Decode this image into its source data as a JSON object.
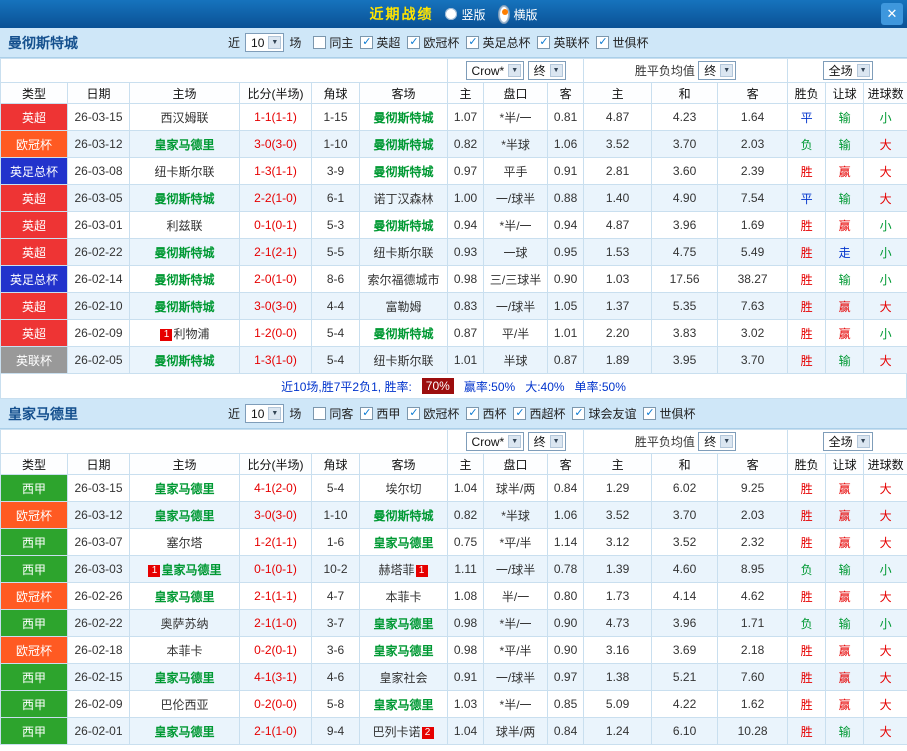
{
  "icons": {
    "chevron_down": "▼",
    "check": "✓",
    "close": "✕"
  },
  "colors": {
    "result": {
      "r": "#e60000",
      "g": "#009933",
      "b": "#0033cc"
    }
  },
  "top_bar": {
    "title": "近期战绩",
    "radio_vertical": "竖版",
    "radio_horizontal": "横版"
  },
  "sections": [
    {
      "team": "曼彻斯特城",
      "near_label": "近",
      "count_value": "10",
      "games_label": "场",
      "filters": [
        {
          "label": "同主",
          "checked": false
        },
        {
          "label": "英超",
          "checked": true
        },
        {
          "label": "欧冠杯",
          "checked": true
        },
        {
          "label": "英足总杯",
          "checked": true
        },
        {
          "label": "英联杯",
          "checked": true
        },
        {
          "label": "世俱杯",
          "checked": true
        }
      ],
      "odds_source": "Crow*",
      "final_label": "终",
      "avg_label": "胜平负均值",
      "scope_label": "全场",
      "columns": [
        "类型",
        "日期",
        "主场",
        "比分(半场)",
        "角球",
        "客场",
        "主",
        "盘口",
        "客",
        "主",
        "和",
        "客",
        "胜负",
        "让球",
        "进球数"
      ],
      "rows": [
        {
          "type": "英超",
          "type_bg": "#ee3434",
          "date": "26-03-15",
          "home": "西汉姆联",
          "home_hl": false,
          "score": "1-1(1-1)",
          "corner": "1-15",
          "away": "曼彻斯特城",
          "away_hl": true,
          "odds": [
            "1.07",
            "*半/一",
            "0.81",
            "4.87",
            "4.23",
            "1.64"
          ],
          "res": [
            "平",
            "输",
            "小"
          ],
          "res_c": [
            "b",
            "g",
            "g"
          ]
        },
        {
          "type": "欧冠杯",
          "type_bg": "#ff5a22",
          "date": "26-03-12",
          "home": "皇家马德里",
          "home_hl": true,
          "score": "3-0(3-0)",
          "corner": "1-10",
          "away": "曼彻斯特城",
          "away_hl": true,
          "odds": [
            "0.82",
            "*半球",
            "1.06",
            "3.52",
            "3.70",
            "2.03"
          ],
          "res": [
            "负",
            "输",
            "大"
          ],
          "res_c": [
            "g",
            "g",
            "r"
          ]
        },
        {
          "type": "英足总杯",
          "type_bg": "#2233cc",
          "date": "26-03-08",
          "home": "纽卡斯尔联",
          "home_hl": false,
          "score": "1-3(1-1)",
          "corner": "3-9",
          "away": "曼彻斯特城",
          "away_hl": true,
          "odds": [
            "0.97",
            "平手",
            "0.91",
            "2.81",
            "3.60",
            "2.39"
          ],
          "res": [
            "胜",
            "赢",
            "大"
          ],
          "res_c": [
            "r",
            "r",
            "r"
          ]
        },
        {
          "type": "英超",
          "type_bg": "#ee3434",
          "date": "26-03-05",
          "home": "曼彻斯特城",
          "home_hl": true,
          "score": "2-2(1-0)",
          "corner": "6-1",
          "away": "诺丁汉森林",
          "away_hl": false,
          "odds": [
            "1.00",
            "一/球半",
            "0.88",
            "1.40",
            "4.90",
            "7.54"
          ],
          "res": [
            "平",
            "输",
            "大"
          ],
          "res_c": [
            "b",
            "g",
            "r"
          ]
        },
        {
          "type": "英超",
          "type_bg": "#ee3434",
          "date": "26-03-01",
          "home": "利兹联",
          "home_hl": false,
          "score": "0-1(0-1)",
          "corner": "5-3",
          "away": "曼彻斯特城",
          "away_hl": true,
          "odds": [
            "0.94",
            "*半/一",
            "0.94",
            "4.87",
            "3.96",
            "1.69"
          ],
          "res": [
            "胜",
            "赢",
            "小"
          ],
          "res_c": [
            "r",
            "r",
            "g"
          ]
        },
        {
          "type": "英超",
          "type_bg": "#ee3434",
          "date": "26-02-22",
          "home": "曼彻斯特城",
          "home_hl": true,
          "score": "2-1(2-1)",
          "corner": "5-5",
          "away": "纽卡斯尔联",
          "away_hl": false,
          "odds": [
            "0.93",
            "一球",
            "0.95",
            "1.53",
            "4.75",
            "5.49"
          ],
          "res": [
            "胜",
            "走",
            "小"
          ],
          "res_c": [
            "r",
            "b",
            "g"
          ]
        },
        {
          "type": "英足总杯",
          "type_bg": "#2233cc",
          "date": "26-02-14",
          "home": "曼彻斯特城",
          "home_hl": true,
          "score": "2-0(1-0)",
          "corner": "8-6",
          "away": "索尔福德城市",
          "away_hl": false,
          "odds": [
            "0.98",
            "三/三球半",
            "0.90",
            "1.03",
            "17.56",
            "38.27"
          ],
          "res": [
            "胜",
            "输",
            "小"
          ],
          "res_c": [
            "r",
            "g",
            "g"
          ]
        },
        {
          "type": "英超",
          "type_bg": "#ee3434",
          "date": "26-02-10",
          "home": "曼彻斯特城",
          "home_hl": true,
          "score": "3-0(3-0)",
          "corner": "4-4",
          "away": "富勒姆",
          "away_hl": false,
          "odds": [
            "0.83",
            "一/球半",
            "1.05",
            "1.37",
            "5.35",
            "7.63"
          ],
          "res": [
            "胜",
            "赢",
            "大"
          ],
          "res_c": [
            "r",
            "r",
            "r"
          ]
        },
        {
          "type": "英超",
          "type_bg": "#ee3434",
          "date": "26-02-09",
          "home": "利物浦",
          "home_hl": false,
          "hbadge": "1",
          "hbadge_pos": "pre",
          "score": "1-2(0-0)",
          "corner": "5-4",
          "away": "曼彻斯特城",
          "away_hl": true,
          "odds": [
            "0.87",
            "平/半",
            "1.01",
            "2.20",
            "3.83",
            "3.02"
          ],
          "res": [
            "胜",
            "赢",
            "小"
          ],
          "res_c": [
            "r",
            "r",
            "g"
          ]
        },
        {
          "type": "英联杯",
          "type_bg": "#999999",
          "date": "26-02-05",
          "home": "曼彻斯特城",
          "home_hl": true,
          "score": "1-3(1-0)",
          "corner": "5-4",
          "away": "纽卡斯尔联",
          "away_hl": false,
          "odds": [
            "1.01",
            "半球",
            "0.87",
            "1.89",
            "3.95",
            "3.70"
          ],
          "res": [
            "胜",
            "输",
            "大"
          ],
          "res_c": [
            "r",
            "g",
            "r"
          ]
        }
      ],
      "summary": {
        "prefix": "近10场,胜7平2负1, 胜率:",
        "win_rate": "70%",
        "stats": [
          "赢率:50%",
          "大:40%",
          "单率:50%"
        ]
      }
    },
    {
      "team": "皇家马德里",
      "near_label": "近",
      "count_value": "10",
      "games_label": "场",
      "filters": [
        {
          "label": "同客",
          "checked": false
        },
        {
          "label": "西甲",
          "checked": true
        },
        {
          "label": "欧冠杯",
          "checked": true
        },
        {
          "label": "西杯",
          "checked": true
        },
        {
          "label": "西超杯",
          "checked": true
        },
        {
          "label": "球会友谊",
          "checked": true
        },
        {
          "label": "世俱杯",
          "checked": true
        }
      ],
      "odds_source": "Crow*",
      "final_label": "终",
      "avg_label": "胜平负均值",
      "scope_label": "全场",
      "columns": [
        "类型",
        "日期",
        "主场",
        "比分(半场)",
        "角球",
        "客场",
        "主",
        "盘口",
        "客",
        "主",
        "和",
        "客",
        "胜负",
        "让球",
        "进球数"
      ],
      "rows": [
        {
          "type": "西甲",
          "type_bg": "#2da42d",
          "date": "26-03-15",
          "home": "皇家马德里",
          "home_hl": true,
          "score": "4-1(2-0)",
          "corner": "5-4",
          "away": "埃尔切",
          "away_hl": false,
          "odds": [
            "1.04",
            "球半/两",
            "0.84",
            "1.29",
            "6.02",
            "9.25"
          ],
          "res": [
            "胜",
            "赢",
            "大"
          ],
          "res_c": [
            "r",
            "r",
            "r"
          ]
        },
        {
          "type": "欧冠杯",
          "type_bg": "#ff5a22",
          "date": "26-03-12",
          "home": "皇家马德里",
          "home_hl": true,
          "score": "3-0(3-0)",
          "corner": "1-10",
          "away": "曼彻斯特城",
          "away_hl": true,
          "odds": [
            "0.82",
            "*半球",
            "1.06",
            "3.52",
            "3.70",
            "2.03"
          ],
          "res": [
            "胜",
            "赢",
            "大"
          ],
          "res_c": [
            "r",
            "r",
            "r"
          ]
        },
        {
          "type": "西甲",
          "type_bg": "#2da42d",
          "date": "26-03-07",
          "home": "塞尔塔",
          "home_hl": false,
          "score": "1-2(1-1)",
          "corner": "1-6",
          "away": "皇家马德里",
          "away_hl": true,
          "odds": [
            "0.75",
            "*平/半",
            "1.14",
            "3.12",
            "3.52",
            "2.32"
          ],
          "res": [
            "胜",
            "赢",
            "大"
          ],
          "res_c": [
            "r",
            "r",
            "r"
          ]
        },
        {
          "type": "西甲",
          "type_bg": "#2da42d",
          "date": "26-03-03",
          "home": "皇家马德里",
          "home_hl": true,
          "hbadge": "1",
          "hbadge_pos": "pre",
          "score": "0-1(0-1)",
          "corner": "10-2",
          "away": "赫塔菲",
          "away_hl": false,
          "abadge": "1",
          "abadge_pos": "post",
          "odds": [
            "1.11",
            "一/球半",
            "0.78",
            "1.39",
            "4.60",
            "8.95"
          ],
          "res": [
            "负",
            "输",
            "小"
          ],
          "res_c": [
            "g",
            "g",
            "g"
          ]
        },
        {
          "type": "欧冠杯",
          "type_bg": "#ff5a22",
          "date": "26-02-26",
          "home": "皇家马德里",
          "home_hl": true,
          "score": "2-1(1-1)",
          "corner": "4-7",
          "away": "本菲卡",
          "away_hl": false,
          "odds": [
            "1.08",
            "半/一",
            "0.80",
            "1.73",
            "4.14",
            "4.62"
          ],
          "res": [
            "胜",
            "赢",
            "大"
          ],
          "res_c": [
            "r",
            "r",
            "r"
          ]
        },
        {
          "type": "西甲",
          "type_bg": "#2da42d",
          "date": "26-02-22",
          "home": "奥萨苏纳",
          "home_hl": false,
          "score": "2-1(1-0)",
          "corner": "3-7",
          "away": "皇家马德里",
          "away_hl": true,
          "odds": [
            "0.98",
            "*半/一",
            "0.90",
            "4.73",
            "3.96",
            "1.71"
          ],
          "res": [
            "负",
            "输",
            "小"
          ],
          "res_c": [
            "g",
            "g",
            "g"
          ]
        },
        {
          "type": "欧冠杯",
          "type_bg": "#ff5a22",
          "date": "26-02-18",
          "home": "本菲卡",
          "home_hl": false,
          "score": "0-2(0-1)",
          "corner": "3-6",
          "away": "皇家马德里",
          "away_hl": true,
          "odds": [
            "0.98",
            "*平/半",
            "0.90",
            "3.16",
            "3.69",
            "2.18"
          ],
          "res": [
            "胜",
            "赢",
            "大"
          ],
          "res_c": [
            "r",
            "r",
            "r"
          ]
        },
        {
          "type": "西甲",
          "type_bg": "#2da42d",
          "date": "26-02-15",
          "home": "皇家马德里",
          "home_hl": true,
          "score": "4-1(3-1)",
          "corner": "4-6",
          "away": "皇家社会",
          "away_hl": false,
          "odds": [
            "0.91",
            "一/球半",
            "0.97",
            "1.38",
            "5.21",
            "7.60"
          ],
          "res": [
            "胜",
            "赢",
            "大"
          ],
          "res_c": [
            "r",
            "r",
            "r"
          ]
        },
        {
          "type": "西甲",
          "type_bg": "#2da42d",
          "date": "26-02-09",
          "home": "巴伦西亚",
          "home_hl": false,
          "score": "0-2(0-0)",
          "corner": "5-8",
          "away": "皇家马德里",
          "away_hl": true,
          "odds": [
            "1.03",
            "*半/一",
            "0.85",
            "5.09",
            "4.22",
            "1.62"
          ],
          "res": [
            "胜",
            "赢",
            "大"
          ],
          "res_c": [
            "r",
            "r",
            "r"
          ]
        },
        {
          "type": "西甲",
          "type_bg": "#2da42d",
          "date": "26-02-01",
          "home": "皇家马德里",
          "home_hl": true,
          "score": "2-1(1-0)",
          "corner": "9-4",
          "away": "巴列卡诺",
          "away_hl": false,
          "abadge": "2",
          "abadge_pos": "post",
          "odds": [
            "1.04",
            "球半/两",
            "0.84",
            "1.24",
            "6.10",
            "10.28"
          ],
          "res": [
            "胜",
            "输",
            "大"
          ],
          "res_c": [
            "r",
            "g",
            "r"
          ]
        }
      ]
    }
  ]
}
